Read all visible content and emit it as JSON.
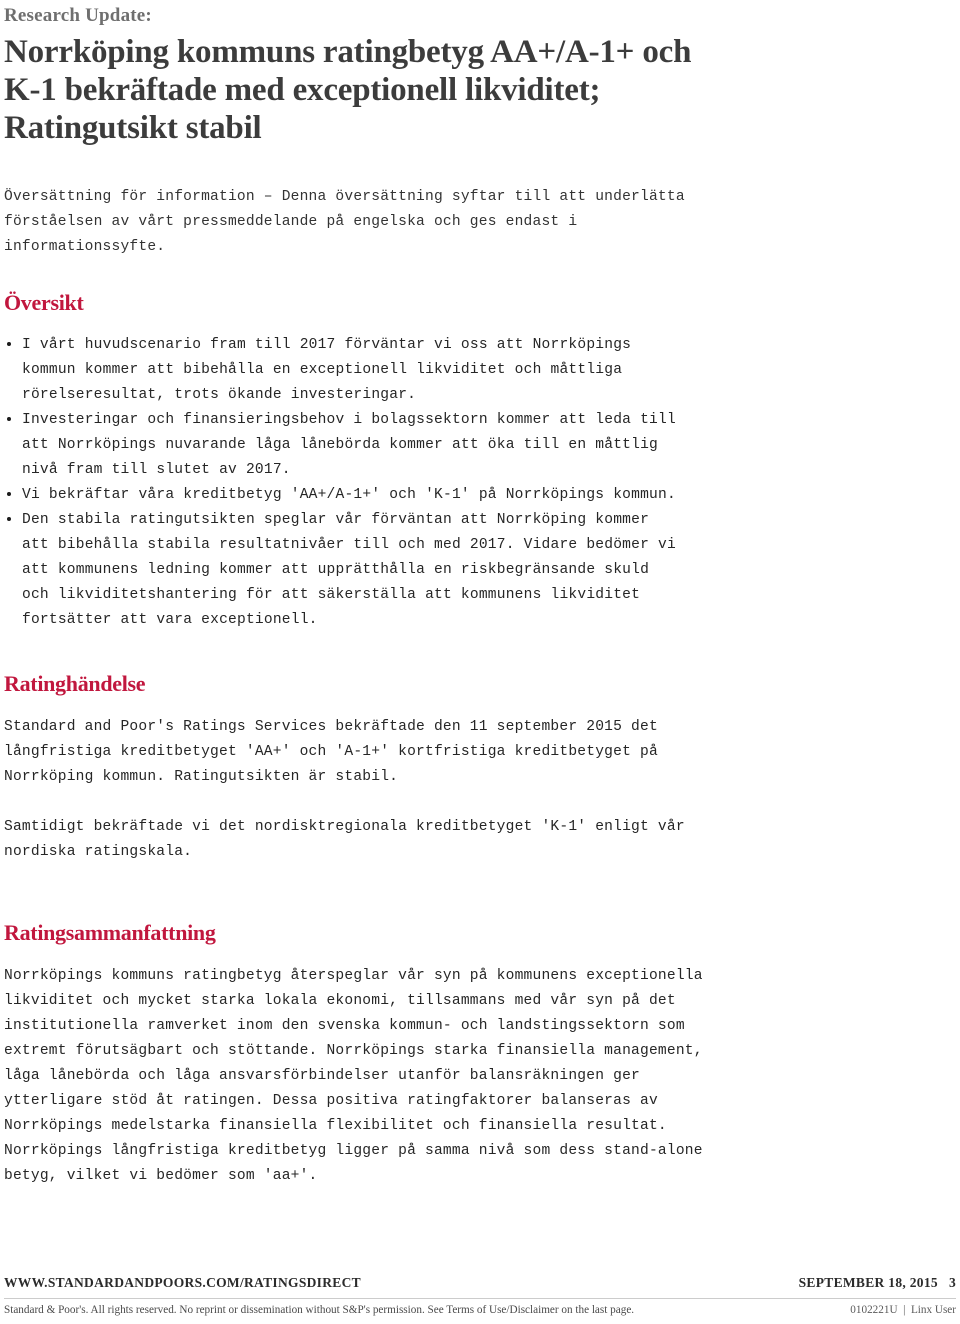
{
  "header": {
    "kicker": "Research Update:",
    "title_lines": [
      "Norrköping kommuns ratingbetyg AA+/A-1+ och",
      "K-1 bekräftade med exceptionell likviditet;",
      "Ratingutsikt stabil"
    ]
  },
  "intro": {
    "lines": [
      "Översättning för information – Denna översättning syftar till att underlätta",
      "förståelsen av vårt pressmeddelande på engelska och ges endast i",
      "informationssyfte."
    ]
  },
  "sections": {
    "overview": {
      "heading": "Översikt",
      "bullets": [
        {
          "lines": [
            "I vårt huvudscenario fram till 2017 förväntar vi oss att Norrköpings",
            "kommun kommer att bibehålla en exceptionell likviditet och måttliga",
            "rörelseresultat, trots ökande investeringar."
          ]
        },
        {
          "lines": [
            "Investeringar och finansieringsbehov i bolagssektorn kommer att leda till",
            "att Norrköpings nuvarande låga lånebörda kommer att öka till en måttlig",
            "nivå fram till slutet av 2017."
          ]
        },
        {
          "lines": [
            "Vi bekräftar våra kreditbetyg 'AA+/A-1+' och 'K-1' på Norrköpings kommun."
          ]
        },
        {
          "lines": [
            "Den stabila ratingutsikten speglar vår förväntan att Norrköping kommer",
            "att bibehålla stabila resultatnivåer till och med 2017. Vidare bedömer vi",
            "att kommunens ledning kommer att upprätthålla en riskbegränsande skuld",
            "och likviditetshantering för att säkerställa att kommunens likviditet",
            "fortsätter att vara exceptionell."
          ]
        }
      ]
    },
    "rating_event": {
      "heading": "Ratinghändelse",
      "paragraphs": [
        {
          "lines": [
            "Standard and Poor's Ratings Services bekräftade den 11 september 2015 det",
            "långfristiga kreditbetyget 'AA+' och 'A-1+' kortfristiga kreditbetyget på",
            "Norrköping kommun. Ratingutsikten är stabil."
          ]
        },
        {
          "lines": [
            "Samtidigt bekräftade vi det nordisktregionala kreditbetyget 'K-1' enligt vår",
            "nordiska ratingskala."
          ]
        }
      ]
    },
    "rating_summary": {
      "heading": "Ratingsammanfattning",
      "paragraphs": [
        {
          "lines": [
            "Norrköpings kommuns ratingbetyg återspeglar vår syn på kommunens exceptionella",
            "likviditet och mycket starka lokala ekonomi, tillsammans med vår syn på det",
            "institutionella ramverket inom den svenska kommun- och landstingssektorn som",
            "extremt förutsägbart och stöttande. Norrköpings starka finansiella management,",
            "låga lånebörda och låga ansvarsförbindelser utanför balansräkningen ger",
            "ytterligare stöd åt ratingen. Dessa positiva ratingfaktorer balanseras av",
            "Norrköpings medelstarka finansiella flexibilitet och finansiella resultat.",
            "Norrköpings långfristiga kreditbetyg ligger på samma nivå som dess stand-alone",
            "betyg, vilket vi bedömer som 'aa+'."
          ]
        }
      ]
    }
  },
  "footer": {
    "site_url": "WWW.STANDARDANDPOORS.COM/RATINGSDIRECT",
    "date_and_page": "SEPTEMBER 18, 2015   3",
    "disclaimer": "Standard & Poor's. All rights reserved. No reprint or dissemination without S&P's permission. See Terms of Use/Disclaimer on the last page.",
    "doc_id": "0102221U  |  Linx User"
  },
  "colors": {
    "heading_red": "#c1173e",
    "kicker_gray": "#6f6f6f",
    "title_gray": "#3c3c3c",
    "body_text": "#262626"
  }
}
